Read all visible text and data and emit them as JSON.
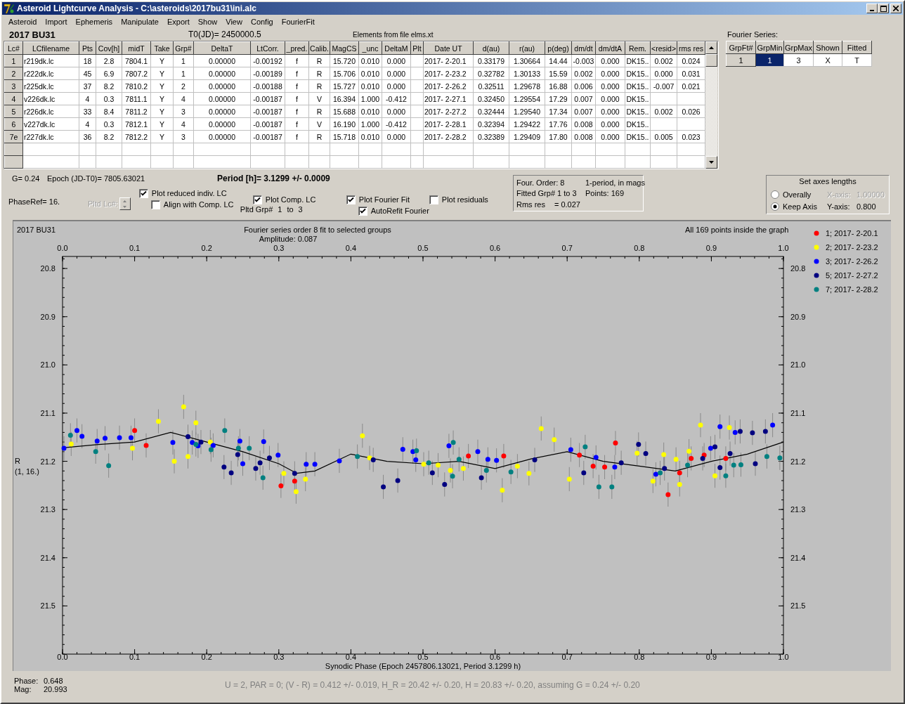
{
  "window": {
    "title": "Asteroid Lightcurve Analysis - C:\\asteroids\\2017bu31\\ini.alc"
  },
  "menu": [
    "Asteroid",
    "Import",
    "Ephemeris",
    "Manipulate",
    "Export",
    "Show",
    "View",
    "Config",
    "FourierFit"
  ],
  "header": {
    "object": "2017 BU31",
    "t0": "T0(JD)= 2450000.5",
    "elements": "Elements from file elms.xt"
  },
  "table": {
    "corner": "Lc#",
    "columns": [
      "LCfilename",
      "Pts",
      "Cov[h]",
      "midT",
      "Take",
      "Grp#",
      "DeltaT",
      "LtCorr.",
      "_pred.",
      "Calib.",
      "MagCS",
      "_unc",
      "DeltaM",
      "Plt",
      "Date UT",
      "d(au)",
      "r(au)",
      "p(deg)",
      "dm/dt",
      "dm/dtA",
      "Rem.",
      "<resid>",
      "rms res"
    ],
    "rows": [
      {
        "header": "1",
        "cells": [
          "r219dk.lc",
          "18",
          "2.8",
          "7804.1",
          "Y",
          "1",
          "0.00000",
          "-0.00192",
          "f",
          "R",
          "15.720",
          "0.010",
          "0.000",
          null,
          "2017- 2-20.1",
          "0.33179",
          "1.30664",
          "14.44",
          "-0.003",
          "0.000",
          "DK15..",
          "0.002",
          "0.024"
        ]
      },
      {
        "header": "2",
        "cells": [
          "r222dk.lc",
          "45",
          "6.9",
          "7807.2",
          "Y",
          "1",
          "0.00000",
          "-0.00189",
          "f",
          "R",
          "15.706",
          "0.010",
          "0.000",
          null,
          "2017- 2-23.2",
          "0.32782",
          "1.30133",
          "15.59",
          "0.002",
          "0.000",
          "DK15..",
          "0.000",
          "0.031"
        ]
      },
      {
        "header": "3",
        "cells": [
          "r225dk.lc",
          "37",
          "8.2",
          "7810.2",
          "Y",
          "2",
          "0.00000",
          "-0.00188",
          "f",
          "R",
          "15.727",
          "0.010",
          "0.000",
          null,
          "2017- 2-26.2",
          "0.32511",
          "1.29678",
          "16.88",
          "0.006",
          "0.000",
          "DK15..",
          "-0.007",
          "0.021"
        ]
      },
      {
        "header": "4",
        "cells": [
          "v226dk.lc",
          "4",
          "0.3",
          "7811.1",
          "Y",
          "4",
          "0.00000",
          "-0.00187",
          "f",
          "V",
          "16.394",
          "1.000",
          "-0.412",
          null,
          "2017- 2-27.1",
          "0.32450",
          "1.29554",
          "17.29",
          "0.007",
          "0.000",
          "DK15..",
          null,
          null
        ]
      },
      {
        "header": "5",
        "cells": [
          "r226dk.lc",
          "33",
          "8.4",
          "7811.2",
          "Y",
          "3",
          "0.00000",
          "-0.00187",
          "f",
          "R",
          "15.688",
          "0.010",
          "0.000",
          null,
          "2017- 2-27.2",
          "0.32444",
          "1.29540",
          "17.34",
          "0.007",
          "0.000",
          "DK15..",
          "0.002",
          "0.026"
        ]
      },
      {
        "header": "6",
        "cells": [
          "v227dk.lc",
          "4",
          "0.3",
          "7812.1",
          "Y",
          "4",
          "0.00000",
          "-0.00187",
          "f",
          "V",
          "16.190",
          "1.000",
          "-0.412",
          null,
          "2017- 2-28.1",
          "0.32394",
          "1.29422",
          "17.76",
          "0.008",
          "0.000",
          "DK15..",
          null,
          null
        ]
      },
      {
        "header": "7e",
        "cells": [
          "r227dk.lc",
          "36",
          "8.2",
          "7812.2",
          "Y",
          "3",
          "0.00000",
          "-0.00187",
          "f",
          "R",
          "15.718",
          "0.010",
          "0.000",
          null,
          "2017- 2-28.2",
          "0.32389",
          "1.29409",
          "17.80",
          "0.008",
          "0.000",
          "DK15..",
          "0.005",
          "0.023"
        ]
      }
    ]
  },
  "fourier_series": {
    "title": "Fourier Series:",
    "columns": [
      "GrpFt#",
      "GrpMin",
      "GrpMax",
      "Shown",
      "Fitted"
    ],
    "rows": [
      {
        "cells": [
          {
            "text": "1",
            "selected": false
          },
          {
            "text": "1",
            "selected": true
          },
          {
            "text": "3",
            "selected": false
          },
          {
            "text": "X",
            "selected": false
          },
          {
            "text": "T",
            "selected": false
          }
        ]
      }
    ]
  },
  "info": {
    "g": "G= 0.24",
    "epoch": "Epoch (JD-T0)= 7805.63021",
    "period": "Period [h]= 3.1299 +/- 0.0009",
    "phase_ref": "PhaseRef= 16.",
    "pltd_lc": {
      "label": "Pltd Lc#:",
      "disabled": true
    },
    "reduced_lc": {
      "label": "Plot reduced indiv. LC",
      "checked": true
    },
    "align_comp": {
      "label": "Align with Comp. LC",
      "checked": false
    },
    "comp_lc": {
      "label": "Plot Comp. LC",
      "checked": true
    },
    "pltd_grp": {
      "label": "Pltd Grp#",
      "from": "1",
      "to_label": "to",
      "to": "3"
    },
    "fourier_fit": {
      "label": "Plot Fourier Fit",
      "checked": true
    },
    "autorefit": {
      "label": "AutoRefit Fourier",
      "checked": true
    },
    "residuals": {
      "label": "Plot residuals",
      "checked": false
    }
  },
  "fourier_info": {
    "order": "Four. Order:  8",
    "mode": "1-period, in mags",
    "fitted": "Fitted Grp# 1 to 3",
    "points": "Points: 169",
    "rms_label": "Rms res",
    "rms_value": "= 0.027"
  },
  "axes": {
    "title": "Set axes lengths",
    "options": [
      {
        "label": "Overally",
        "selected": false,
        "axis_label": "X-axis:",
        "value": "1.00000",
        "disabled": true
      },
      {
        "label": "Keep Axis",
        "selected": true,
        "axis_label": "Y-axis:",
        "value": "0.800",
        "disabled": false
      }
    ]
  },
  "chart": {
    "object": "2017 BU31",
    "title": "Fourier series order 8 fit to selected groups",
    "amplitude": "Amplitude: 0.087",
    "note": "All 169 points inside the graph",
    "ylabel_lines": [
      "R",
      "(1, 16.)"
    ],
    "top_tick_labels": [
      "0.0",
      "0.1",
      "0.2",
      "0.3",
      "0.4",
      "0.5",
      "0.6",
      "0.7",
      "0.8",
      "0.9",
      "1.0"
    ],
    "right_tick_labels": [
      "20.8",
      "20.9",
      "21.0",
      "21.1",
      "21.2",
      "21.3",
      "21.4",
      "21.5"
    ],
    "chart_data": {
      "type": "scatter",
      "xlabel": "Synodic Phase (Epoch 2457806.13021, Period 3.1299 h)",
      "xlim": [
        0,
        1
      ],
      "ylim": [
        21.6,
        20.775
      ],
      "legend": true,
      "xticks": [
        {
          "value": 0,
          "label": "0.0"
        },
        {
          "value": 0.1,
          "label": "0.1"
        },
        {
          "value": 0.2,
          "label": "0.2"
        },
        {
          "value": 0.3,
          "label": "0.3"
        },
        {
          "value": 0.4,
          "label": "0.4"
        },
        {
          "value": 0.5,
          "label": "0.5"
        },
        {
          "value": 0.6,
          "label": "0.6"
        },
        {
          "value": 0.7,
          "label": "0.7"
        },
        {
          "value": 0.8,
          "label": "0.8"
        },
        {
          "value": 0.9,
          "label": "0.9"
        },
        {
          "value": 1,
          "label": "1.0"
        }
      ],
      "yticks": [
        {
          "value": 20.8,
          "label": "20.8"
        },
        {
          "value": 20.9,
          "label": "20.9"
        },
        {
          "value": 21,
          "label": "21.0"
        },
        {
          "value": 21.1,
          "label": "21.1"
        },
        {
          "value": 21.2,
          "label": "21.2"
        },
        {
          "value": 21.3,
          "label": "21.3"
        },
        {
          "value": 21.4,
          "label": "21.4"
        },
        {
          "value": 21.5,
          "label": "21.5"
        }
      ],
      "series": [
        {
          "name": "1; 2017- 2-20.1",
          "type": "scatter",
          "color": "#ff0000",
          "x": [
            0.1,
            0.116,
            0.303,
            0.322,
            0.563,
            0.612,
            0.717,
            0.736,
            0.752,
            0.767,
            0.84,
            0.856,
            0.872,
            0.89,
            0.92
          ],
          "values": [
            21.136,
            21.167,
            21.251,
            21.241,
            21.189,
            21.189,
            21.187,
            21.21,
            21.212,
            21.162,
            21.269,
            21.224,
            21.194,
            21.187,
            21.194
          ]
        },
        {
          "name": "2; 2017- 2-23.2",
          "type": "scatter",
          "color": "#ffff00",
          "x": [
            0.012,
            0.097,
            0.133,
            0.155,
            0.168,
            0.174,
            0.185,
            0.205,
            0.307,
            0.324,
            0.337,
            0.416,
            0.426,
            0.501,
            0.521,
            0.538,
            0.556,
            0.61,
            0.631,
            0.647,
            0.664,
            0.682,
            0.703,
            0.797,
            0.819,
            0.834,
            0.851,
            0.856,
            0.869,
            0.885,
            0.905,
            0.925
          ],
          "values": [
            21.164,
            21.173,
            21.117,
            21.2,
            21.087,
            21.19,
            21.12,
            21.16,
            21.225,
            21.263,
            21.237,
            21.147,
            21.193,
            21.206,
            21.208,
            21.219,
            21.215,
            21.26,
            21.21,
            21.225,
            21.132,
            21.155,
            21.237,
            21.183,
            21.241,
            21.186,
            21.196,
            21.248,
            21.179,
            21.125,
            21.23,
            21.13
          ]
        },
        {
          "name": "3; 2017- 2-26.2",
          "type": "scatter",
          "color": "#0000ff",
          "x": [
            0.002,
            0.02,
            0.027,
            0.048,
            0.059,
            0.079,
            0.095,
            0.153,
            0.18,
            0.188,
            0.209,
            0.246,
            0.25,
            0.279,
            0.299,
            0.338,
            0.35,
            0.384,
            0.472,
            0.486,
            0.49,
            0.536,
            0.576,
            0.59,
            0.602,
            0.705,
            0.74,
            0.766,
            0.823,
            0.899,
            0.912,
            0.933,
            0.985
          ],
          "values": [
            21.173,
            21.136,
            21.148,
            21.158,
            21.152,
            21.151,
            21.151,
            21.161,
            21.161,
            21.168,
            21.167,
            21.158,
            21.205,
            21.159,
            21.187,
            21.206,
            21.206,
            21.199,
            21.175,
            21.18,
            21.197,
            21.168,
            21.18,
            21.196,
            21.198,
            21.176,
            21.192,
            21.212,
            21.227,
            21.173,
            21.128,
            21.14,
            21.125
          ]
        },
        {
          "name": "5; 2017- 2-27.2",
          "type": "scatter",
          "color": "#000080",
          "x": [
            0.174,
            0.192,
            0.224,
            0.234,
            0.243,
            0.268,
            0.274,
            0.287,
            0.322,
            0.431,
            0.445,
            0.465,
            0.513,
            0.53,
            0.581,
            0.655,
            0.723,
            0.775,
            0.799,
            0.809,
            0.835,
            0.888,
            0.905,
            0.912,
            0.926,
            0.94,
            0.957,
            0.961,
            0.975
          ],
          "values": [
            21.149,
            21.16,
            21.212,
            21.224,
            21.186,
            21.215,
            21.203,
            21.193,
            21.225,
            21.197,
            21.253,
            21.24,
            21.224,
            21.248,
            21.234,
            21.197,
            21.224,
            21.203,
            21.165,
            21.184,
            21.215,
            21.194,
            21.17,
            21.213,
            21.184,
            21.138,
            21.141,
            21.205,
            21.138
          ]
        },
        {
          "name": "7; 2017- 2-28.2",
          "type": "scatter",
          "color": "#008080",
          "x": [
            0.011,
            0.046,
            0.064,
            0.185,
            0.206,
            0.225,
            0.244,
            0.259,
            0.278,
            0.409,
            0.491,
            0.508,
            0.542,
            0.55,
            0.541,
            0.588,
            0.622,
            0.725,
            0.744,
            0.762,
            0.829,
            0.867,
            0.92,
            0.931,
            0.941,
            0.977,
            0.995
          ],
          "values": [
            21.146,
            21.18,
            21.209,
            21.165,
            21.176,
            21.136,
            21.173,
            21.173,
            21.234,
            21.19,
            21.178,
            21.203,
            21.161,
            21.196,
            21.231,
            21.219,
            21.222,
            21.17,
            21.253,
            21.253,
            21.224,
            21.208,
            21.23,
            21.208,
            21.207,
            21.19,
            21.193
          ]
        },
        {
          "type": "line",
          "color": "#000000",
          "x": [
            0,
            0.05,
            0.1,
            0.15,
            0.2,
            0.25,
            0.3,
            0.325,
            0.35,
            0.4,
            0.45,
            0.5,
            0.55,
            0.6,
            0.65,
            0.7,
            0.75,
            0.8,
            0.85,
            0.9,
            0.95,
            1.0
          ],
          "values": [
            21.172,
            21.165,
            21.16,
            21.14,
            21.16,
            21.18,
            21.205,
            21.225,
            21.22,
            21.185,
            21.2,
            21.205,
            21.2,
            21.215,
            21.195,
            21.18,
            21.2,
            21.21,
            21.22,
            21.2,
            21.185,
            21.16
          ]
        }
      ]
    }
  },
  "status": {
    "phase_label": "Phase:",
    "phase": "0.648",
    "mag_label": "Mag:",
    "mag": "20.993",
    "summary": "U = 2, PAR = 0; (V - R) = 0.412 +/- 0.019, H_R = 20.42 +/- 0.20, H = 20.83 +/- 0.20, assuming G = 0.24 +/- 0.20"
  }
}
